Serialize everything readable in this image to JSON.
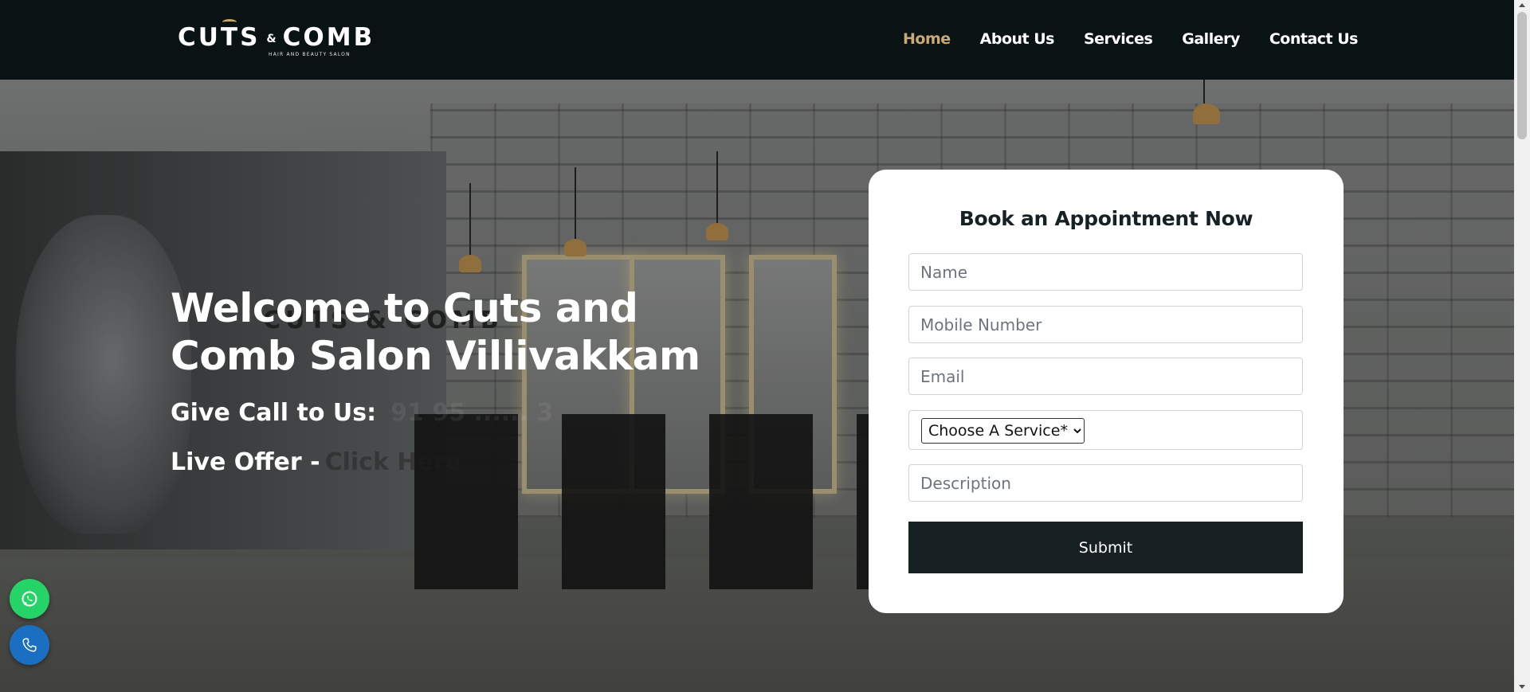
{
  "brand": {
    "name_left": "CUTS",
    "name_amp": "&",
    "name_right": "COMB",
    "tagline": "HAIR AND BEAUTY SALON",
    "accent_color": "#c8a977"
  },
  "nav": {
    "items": [
      {
        "label": "Home",
        "active": true
      },
      {
        "label": "About Us"
      },
      {
        "label": "Services"
      },
      {
        "label": "Gallery"
      },
      {
        "label": "Contact Us"
      }
    ]
  },
  "hero": {
    "poster_brand": "CUTS & COMB",
    "title": "Welcome to Cuts and Comb Salon Villivakkam",
    "call_label": "Give Call to Us:",
    "call_number": "91 95 ...... 3",
    "offer_label": "Live Offer -",
    "offer_link": "Click Here"
  },
  "form": {
    "title": "Book an Appointment Now",
    "name_placeholder": "Name",
    "mobile_placeholder": "Mobile Number",
    "email_placeholder": "Email",
    "service_selected": "Choose A Service*",
    "description_placeholder": "Description",
    "submit_label": "Submit",
    "button_color": "#172124"
  },
  "floating": {
    "whatsapp_icon": "whatsapp-icon",
    "phone_icon": "phone-icon",
    "whatsapp_color": "#25d366",
    "phone_color": "#1a6fc2"
  }
}
